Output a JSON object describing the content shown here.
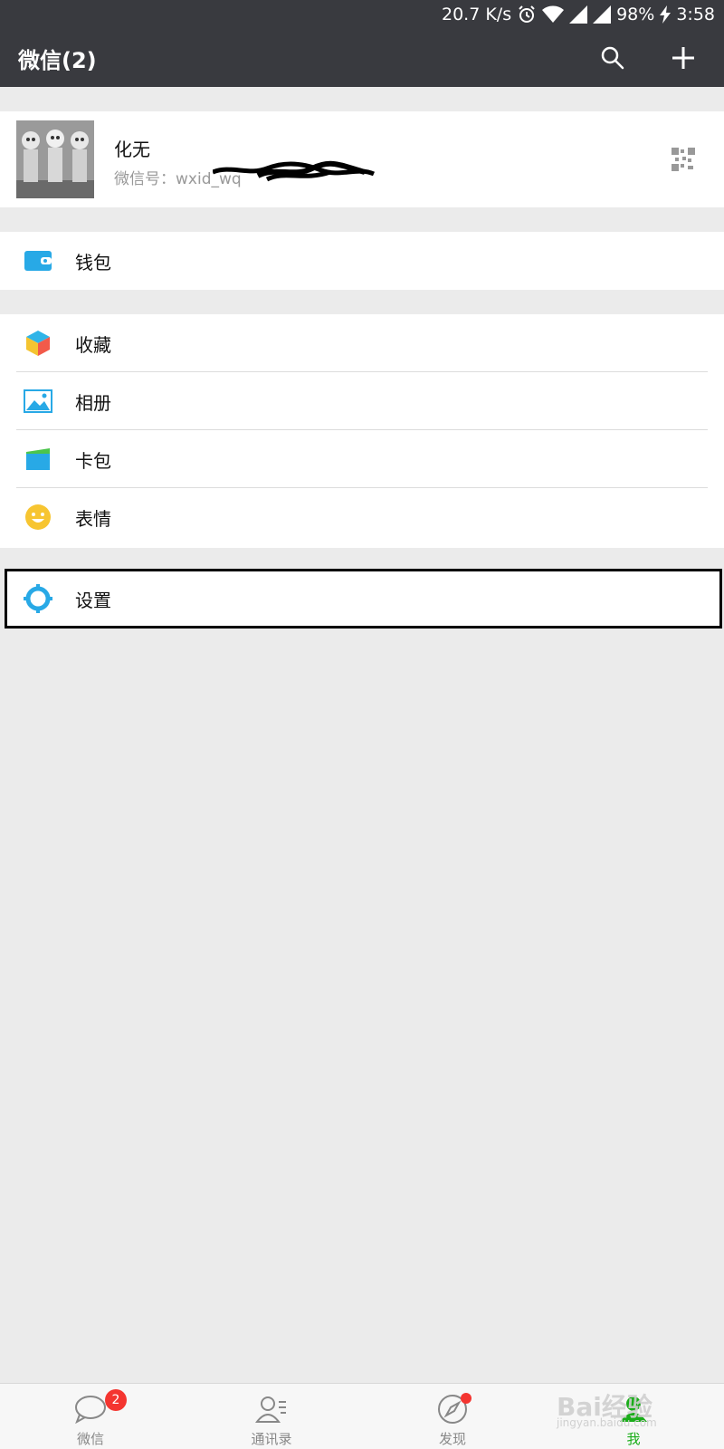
{
  "status_bar": {
    "net_speed": "20.7 K/s",
    "battery": "98%",
    "time": "3:58",
    "icons": [
      "alarm-icon",
      "wifi-icon",
      "signal-icon",
      "signal-icon",
      "charging-icon"
    ]
  },
  "header": {
    "title": "微信(2)",
    "icons": [
      "search-icon",
      "plus-icon"
    ]
  },
  "profile": {
    "nickname": "化无",
    "wechat_id_label": "微信号：",
    "wechat_id_value": "wxid_wq",
    "qr_icon": "qr-code-icon"
  },
  "menu": {
    "wallet": "钱包",
    "favorites": "收藏",
    "album": "相册",
    "cards": "卡包",
    "stickers": "表情",
    "settings": "设置"
  },
  "tabbar": {
    "tabs": [
      {
        "label": "微信",
        "icon": "chat-icon",
        "badge": "2"
      },
      {
        "label": "通讯录",
        "icon": "contacts-icon"
      },
      {
        "label": "发现",
        "icon": "compass-icon"
      },
      {
        "label": "我",
        "icon": "me-icon"
      }
    ],
    "active": "我"
  },
  "watermark": {
    "text": "Bai经验",
    "sub": "jingyan.baidu.com"
  },
  "colors": {
    "header_bg": "#393a3f",
    "active_green": "#1aad19",
    "badge_red": "#f43530",
    "page_bg": "#ebebeb"
  }
}
